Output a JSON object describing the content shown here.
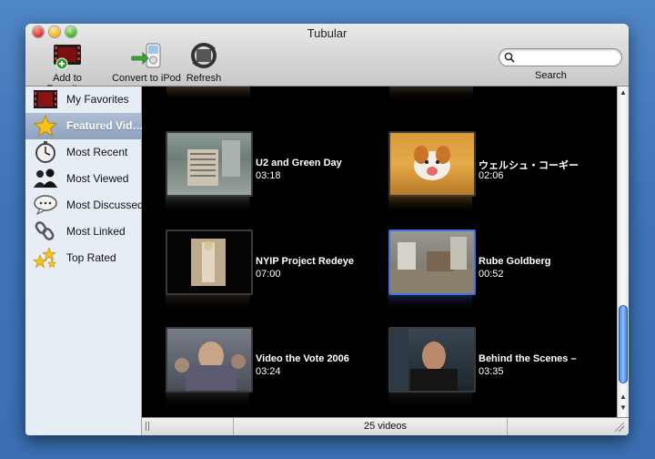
{
  "window": {
    "title": "Tubular"
  },
  "toolbar": {
    "add_favorites": "Add to Favorites",
    "convert_ipod": "Convert to iPod",
    "refresh": "Refresh",
    "search_placeholder": "",
    "search_label": "Search"
  },
  "sidebar": {
    "items": [
      {
        "label": "My Favorites",
        "icon": "film-strip-icon"
      },
      {
        "label": "Featured Vid…",
        "icon": "star-icon",
        "selected": true
      },
      {
        "label": "Most Recent",
        "icon": "stopwatch-icon"
      },
      {
        "label": "Most Viewed",
        "icon": "people-icon"
      },
      {
        "label": "Most Discussed",
        "icon": "speech-bubble-icon"
      },
      {
        "label": "Most Linked",
        "icon": "chain-link-icon"
      },
      {
        "label": "Top Rated",
        "icon": "stars-icon"
      }
    ]
  },
  "videos": [
    {
      "title": "U2 and Green Day",
      "duration": "03:18"
    },
    {
      "title": "ウェルシュ・コーギー",
      "duration": "02:06"
    },
    {
      "title": "NYIP Project Redeye",
      "duration": "07:00"
    },
    {
      "title": "Rube Goldberg",
      "duration": "00:52",
      "selected": true
    },
    {
      "title": "Video the Vote 2006",
      "duration": "03:24"
    },
    {
      "title": "Behind the Scenes –",
      "duration": "03:35"
    }
  ],
  "status": {
    "count_text": "25 videos"
  },
  "colors": {
    "accent": "#3e72e0",
    "selection": "#8ea2c0",
    "content_bg": "#000000"
  }
}
